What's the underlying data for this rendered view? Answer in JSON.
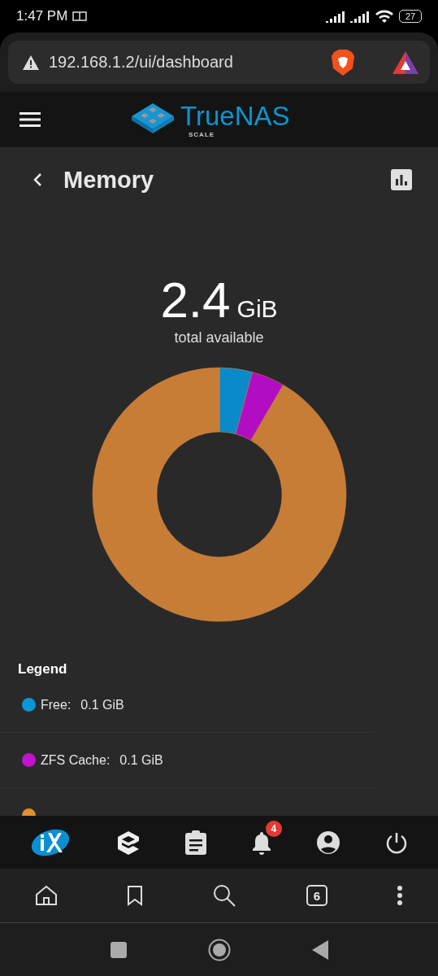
{
  "status_bar": {
    "time": "1:47 PM",
    "battery": "27"
  },
  "browser": {
    "url": "192.168.1.2/ui/dashboard",
    "tab_count": "6"
  },
  "app_header": {
    "logo_text": "TrueNAS",
    "logo_subtitle": "SCALE"
  },
  "page": {
    "title": "Memory",
    "total_value": "2.4",
    "total_unit": "GiB",
    "total_caption": "total available",
    "chart_data": {
      "type": "donut",
      "values": [
        4.2,
        4.2,
        91.6
      ],
      "colors": [
        "#0a8ac8",
        "#b20dc2",
        "#c87d37"
      ]
    },
    "legend": {
      "title": "Legend",
      "items": [
        {
          "label": "Free:",
          "value": "0.1 GiB",
          "color": "#0a95d8"
        },
        {
          "label": "ZFS Cache:",
          "value": "0.1 GiB",
          "color": "#c015cc"
        },
        {
          "color": "#e0902f"
        }
      ]
    }
  },
  "app_nav": {
    "notification_count": "4"
  }
}
